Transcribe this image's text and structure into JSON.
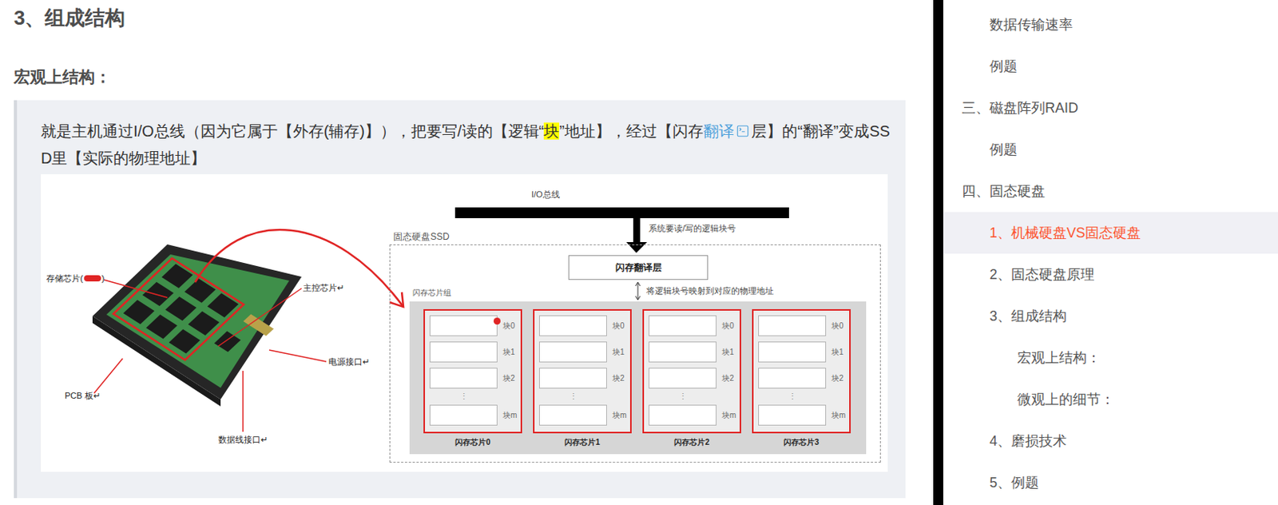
{
  "article": {
    "heading": "3、组成结构",
    "subheading": "宏观上结构：",
    "quote": [
      {
        "text": "就是主机通过I/O总线（因为它属于【外存(辅存)】），把要写/读的【逻辑“",
        "kind": "plain"
      },
      {
        "text": "块",
        "kind": "highlight"
      },
      {
        "text": "”地址】，经过【闪存",
        "kind": "plain"
      },
      {
        "text": "翻译",
        "kind": "link"
      },
      {
        "text": "层】的“翻译”变成SSD里【实际的物理地址】",
        "kind": "plain"
      }
    ]
  },
  "figure": {
    "photo_labels": [
      {
        "text": "存储芯片(",
        "redacted": true,
        "after": ")"
      },
      {
        "text": "主控芯片↵",
        "redacted": false,
        "after": ""
      },
      {
        "text": "电源接口↵",
        "redacted": false,
        "after": ""
      },
      {
        "text": "PCB 板↵",
        "redacted": false,
        "after": ""
      },
      {
        "text": "数据线接口↵",
        "redacted": false,
        "after": ""
      }
    ],
    "bus_label": "I/O总线",
    "request_label": "系统要读/写的逻辑块号",
    "ssd_label": "固态硬盘SSD",
    "ftl_label": "闪存翻译层",
    "mapping_label": "将逻辑块号映射到对应的物理地址",
    "group_label": "闪存芯片组",
    "chips": [
      {
        "name": "闪存芯片0",
        "ellipsis": "⋮",
        "blocks": [
          {
            "label": "块0",
            "marked": true
          },
          {
            "label": "块1",
            "marked": false
          },
          {
            "label": "块2",
            "marked": false
          },
          {
            "label": "块m",
            "marked": false
          }
        ]
      },
      {
        "name": "闪存芯片1",
        "ellipsis": "⋮",
        "blocks": [
          {
            "label": "块0",
            "marked": false
          },
          {
            "label": "块1",
            "marked": false
          },
          {
            "label": "块2",
            "marked": false
          },
          {
            "label": "块m",
            "marked": false
          }
        ]
      },
      {
        "name": "闪存芯片2",
        "ellipsis": "⋮",
        "blocks": [
          {
            "label": "块0",
            "marked": false
          },
          {
            "label": "块1",
            "marked": false
          },
          {
            "label": "块2",
            "marked": false
          },
          {
            "label": "块m",
            "marked": false
          }
        ]
      },
      {
        "name": "闪存芯片3",
        "ellipsis": "⋮",
        "blocks": [
          {
            "label": "块0",
            "marked": false
          },
          {
            "label": "块1",
            "marked": false
          },
          {
            "label": "块2",
            "marked": false
          },
          {
            "label": "块m",
            "marked": false
          }
        ]
      }
    ]
  },
  "toc": {
    "items": [
      {
        "label": "数据传输速率",
        "kind": "h2",
        "selected": false
      },
      {
        "label": "例题",
        "kind": "h2",
        "selected": false
      },
      {
        "label": "三、磁盘阵列RAID",
        "kind": "h1",
        "selected": false
      },
      {
        "label": "例题",
        "kind": "h2",
        "selected": false
      },
      {
        "label": "四、固态硬盘",
        "kind": "h1",
        "selected": false
      },
      {
        "label": "1、机械硬盘VS固态硬盘",
        "kind": "h2",
        "selected": true
      },
      {
        "label": "2、固态硬盘原理",
        "kind": "h2",
        "selected": false
      },
      {
        "label": "3、组成结构",
        "kind": "h2",
        "selected": false
      },
      {
        "label": "宏观上结构：",
        "kind": "h3",
        "selected": false
      },
      {
        "label": "微观上的细节：",
        "kind": "h3",
        "selected": false
      },
      {
        "label": "4、磨损技术",
        "kind": "h2",
        "selected": false
      },
      {
        "label": "5、例题",
        "kind": "h2",
        "selected": false
      }
    ]
  }
}
